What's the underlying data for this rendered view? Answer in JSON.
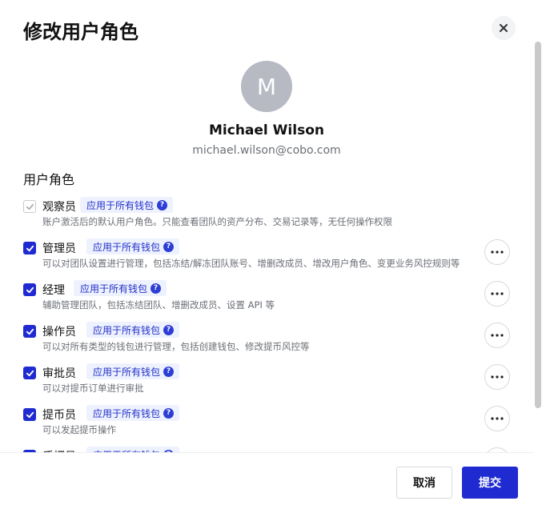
{
  "modal": {
    "title": "修改用户角色",
    "close_icon": "close-icon"
  },
  "user": {
    "avatar_initial": "M",
    "name": "Michael Wilson",
    "email": "michael.wilson@cobo.com"
  },
  "section_title": "用户角色",
  "roles": [
    {
      "name": "观察员",
      "badge": "应用于所有钱包",
      "desc": "账户激活后的默认用户角色。只能查看团队的资产分布、交易记录等，无任何操作权限",
      "checked": true,
      "disabled": true,
      "has_more": false
    },
    {
      "name": "管理员",
      "badge": "应用于所有钱包",
      "desc": "可以对团队设置进行管理，包括冻结/解冻团队账号、增删改成员、增改用户角色、变更业务风控规则等",
      "checked": true,
      "disabled": false,
      "has_more": true
    },
    {
      "name": "经理",
      "badge": "应用于所有钱包",
      "desc": "辅助管理团队，包括冻结团队、增删改成员、设置 API 等",
      "checked": true,
      "disabled": false,
      "has_more": true
    },
    {
      "name": "操作员",
      "badge": "应用于所有钱包",
      "desc": "可以对所有类型的钱包进行管理，包括创建钱包、修改提币风控等",
      "checked": true,
      "disabled": false,
      "has_more": true
    },
    {
      "name": "审批员",
      "badge": "应用于所有钱包",
      "desc": "可以对提币订单进行审批",
      "checked": true,
      "disabled": false,
      "has_more": true
    },
    {
      "name": "提币员",
      "badge": "应用于所有钱包",
      "desc": "可以发起提币操作",
      "checked": true,
      "disabled": false,
      "has_more": true
    },
    {
      "name": "质押员",
      "badge": "应用于所有钱包",
      "desc": "",
      "checked": true,
      "disabled": false,
      "has_more": true
    }
  ],
  "footer": {
    "cancel_label": "取消",
    "submit_label": "提交"
  },
  "colors": {
    "primary": "#1f2bd0",
    "badge_bg": "#eef2ff",
    "avatar_bg": "#b7bac3"
  }
}
